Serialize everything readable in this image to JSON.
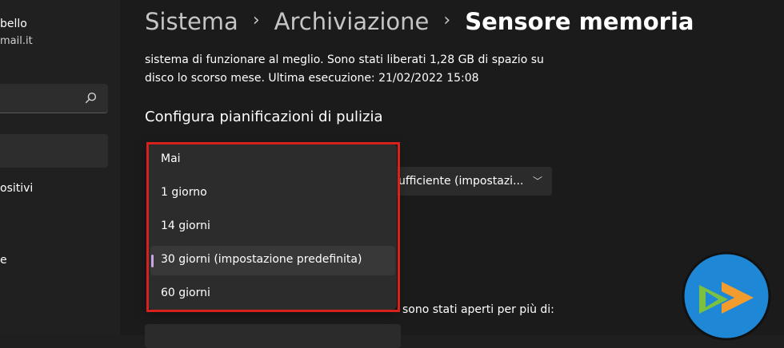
{
  "sidebar": {
    "profile_name": "bello",
    "profile_email": "mail.it",
    "nav_item_1": "ositivi",
    "nav_item_2": "e"
  },
  "header": {
    "crumb_1": "Sistema",
    "crumb_2": "Archiviazione",
    "crumb_3": "Sensore memoria"
  },
  "main": {
    "desc_line_1": "sistema di funzionare al meglio. Sono stati liberati 1,28 GB di spazio su",
    "desc_line_2": "disco lo scorso mese. Ultima esecuzione: 21/02/2022 15:08",
    "section_title": "Configura pianificazioni di pulizia",
    "select_behind_value": "ufficiente (impostazi...",
    "text_behind": "sono stati aperti per più di:"
  },
  "dropdown": {
    "options": [
      "Mai",
      "1 giorno",
      "14 giorni",
      "30 giorni (impostazione predefinita)",
      "60 giorni"
    ],
    "selected_index": 3
  },
  "colors": {
    "accent": "#c9a6e3",
    "highlight": "#d7211c",
    "logo_bg": "#1e88d6"
  }
}
